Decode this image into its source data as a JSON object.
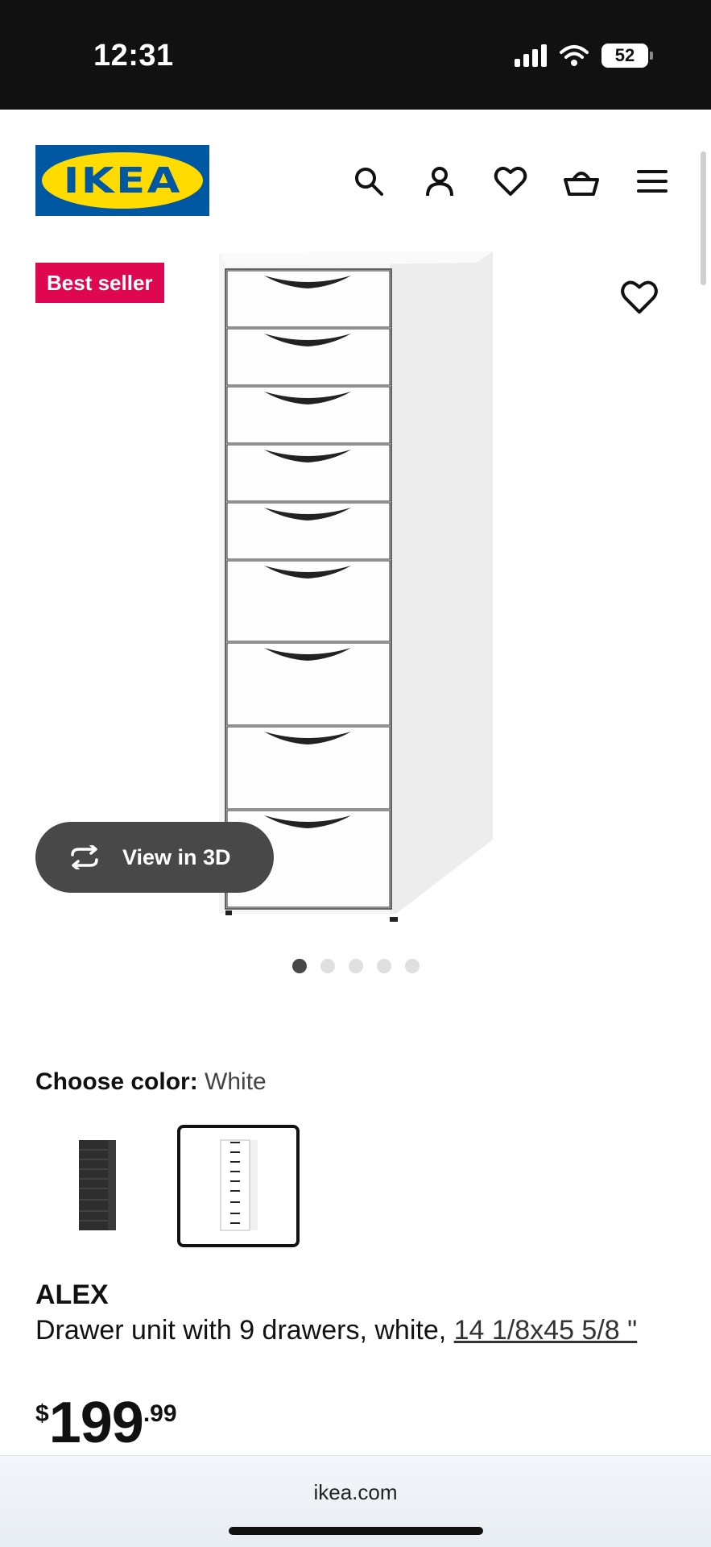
{
  "status_bar": {
    "time": "12:31",
    "battery": "52"
  },
  "header": {
    "logo_text": "IKEA",
    "icons": [
      "search-icon",
      "account-icon",
      "heart-icon",
      "basket-icon",
      "menu-icon"
    ]
  },
  "product_gallery": {
    "badge": "Best seller",
    "view_3d_label": "View in 3D",
    "image_count": 5,
    "active_image": 1
  },
  "color_chooser": {
    "label": "Choose color:",
    "value": "White",
    "options": [
      "black-brown",
      "white"
    ],
    "selected": "white"
  },
  "product": {
    "name": "ALEX",
    "description": "Drawer unit with 9 drawers, white, ",
    "size_link": "14 1/8x45 5/8 \"",
    "price_currency": "$",
    "price_integer": "199",
    "price_decimal": ".99"
  },
  "browser": {
    "url": "ikea.com"
  },
  "colors": {
    "ikea_blue": "#0058a3",
    "ikea_yellow": "#ffdb00",
    "badge_red": "#e00751",
    "dark_button": "#484848"
  }
}
